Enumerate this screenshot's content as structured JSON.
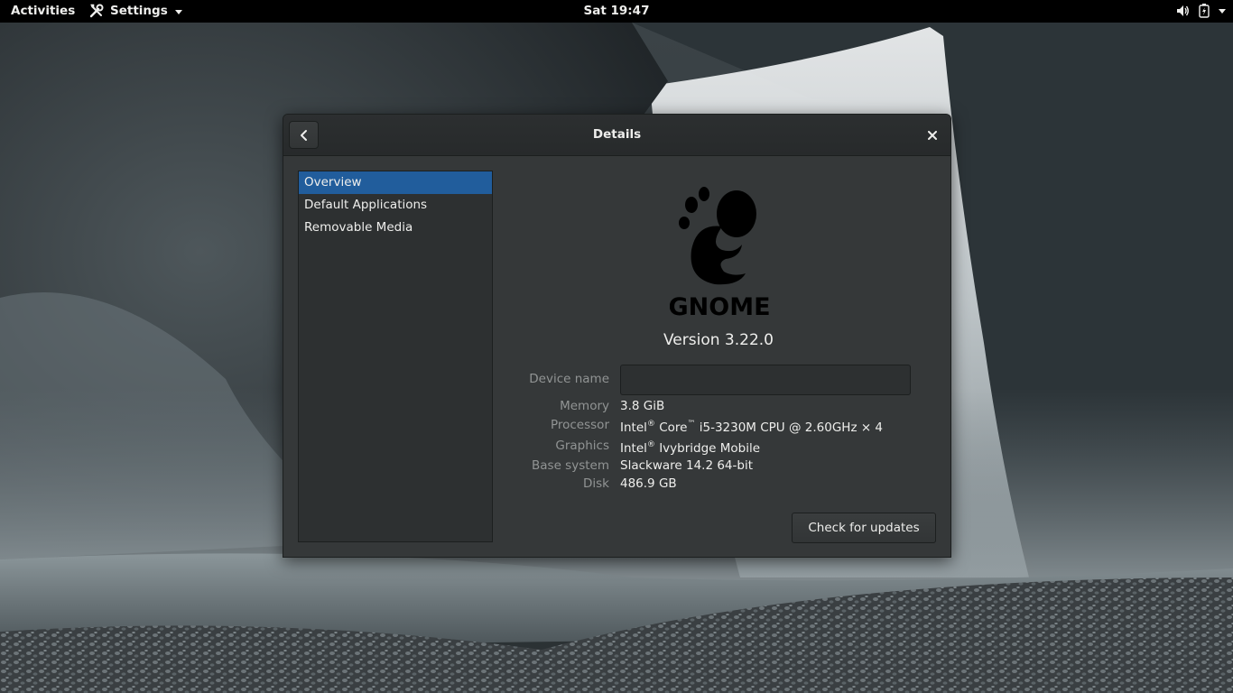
{
  "topbar": {
    "activities": "Activities",
    "app_menu": "Settings",
    "clock": "Sat 19:47",
    "icons": [
      "volume-icon",
      "battery-icon",
      "system-menu-arrow-icon"
    ]
  },
  "window": {
    "title": "Details",
    "back_icon": "chevron-left-icon",
    "close_icon": "close-icon"
  },
  "sidebar": {
    "items": [
      {
        "label": "Overview",
        "selected": true
      },
      {
        "label": "Default Applications",
        "selected": false
      },
      {
        "label": "Removable Media",
        "selected": false
      }
    ]
  },
  "overview": {
    "logo_text": "GNOME",
    "version": "Version 3.22.0",
    "device_name": {
      "label": "Device name",
      "value": ""
    },
    "memory": {
      "label": "Memory",
      "value": "3.8 GiB"
    },
    "processor": {
      "label": "Processor",
      "brand": "Intel",
      "reg": "®",
      "product": "Core",
      "tm": "™",
      "rest": "i5-3230M CPU @ 2.60GHz × 4"
    },
    "graphics": {
      "label": "Graphics",
      "brand": "Intel",
      "reg": "®",
      "rest": "Ivybridge Mobile"
    },
    "base_system": {
      "label": "Base system",
      "value": "Slackware 14.2 64-bit"
    },
    "disk": {
      "label": "Disk",
      "value": "486.9 GB"
    },
    "updates_button": "Check for updates"
  },
  "colors": {
    "accent": "#215d9c",
    "window_bg": "#353839",
    "sidebar_bg": "#2d3031",
    "label_text": "#919494"
  }
}
